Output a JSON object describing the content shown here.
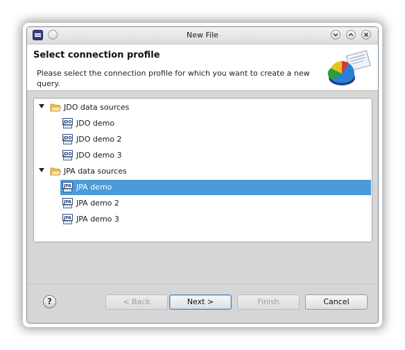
{
  "window": {
    "title": "New File"
  },
  "header": {
    "title": "Select connection profile",
    "description": "Please select the connection profile for which you want to create a new query."
  },
  "tree": {
    "groups": [
      {
        "label": "JDO data sources",
        "expanded": true,
        "items": [
          {
            "label": "JDO demo",
            "badge": "JDO",
            "selected": false
          },
          {
            "label": "JDO demo 2",
            "badge": "JDO",
            "selected": false
          },
          {
            "label": "JDO demo 3",
            "badge": "JDO",
            "selected": false
          }
        ]
      },
      {
        "label": "JPA data sources",
        "expanded": true,
        "items": [
          {
            "label": "JPA demo",
            "badge": "JPA",
            "selected": true
          },
          {
            "label": "JPA demo 2",
            "badge": "JPA",
            "selected": false
          },
          {
            "label": "JPA demo 3",
            "badge": "JPA",
            "selected": false
          }
        ]
      }
    ]
  },
  "buttons": {
    "back": "< Back",
    "next": "Next >",
    "finish": "Finish",
    "cancel": "Cancel"
  },
  "icons": {
    "help": "help-icon",
    "app": "eclipse-app-icon",
    "folder": "folder-open-icon",
    "datasource": "datasource-icon"
  },
  "colors": {
    "selection": "#4a9bd8",
    "dialog_bg": "#d6d6d6",
    "default_button_border": "#4a86c5"
  }
}
